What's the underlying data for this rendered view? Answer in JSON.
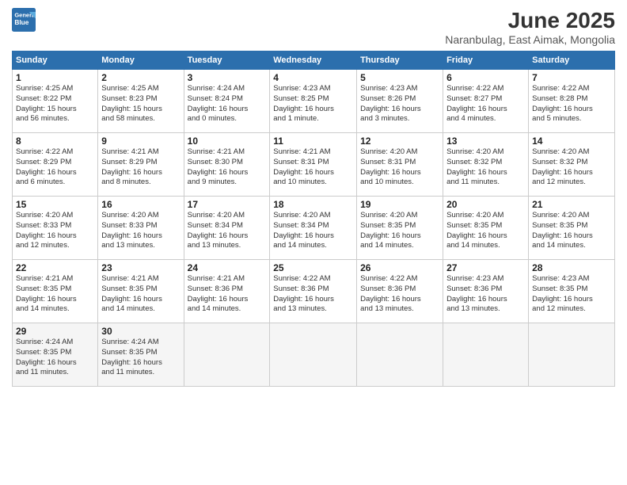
{
  "logo": {
    "line1": "General",
    "line2": "Blue"
  },
  "title": "June 2025",
  "subtitle": "Naranbulag, East Aimak, Mongolia",
  "days_of_week": [
    "Sunday",
    "Monday",
    "Tuesday",
    "Wednesday",
    "Thursday",
    "Friday",
    "Saturday"
  ],
  "weeks": [
    [
      {
        "day": "1",
        "info": "Sunrise: 4:25 AM\nSunset: 8:22 PM\nDaylight: 15 hours\nand 56 minutes."
      },
      {
        "day": "2",
        "info": "Sunrise: 4:25 AM\nSunset: 8:23 PM\nDaylight: 15 hours\nand 58 minutes."
      },
      {
        "day": "3",
        "info": "Sunrise: 4:24 AM\nSunset: 8:24 PM\nDaylight: 16 hours\nand 0 minutes."
      },
      {
        "day": "4",
        "info": "Sunrise: 4:23 AM\nSunset: 8:25 PM\nDaylight: 16 hours\nand 1 minute."
      },
      {
        "day": "5",
        "info": "Sunrise: 4:23 AM\nSunset: 8:26 PM\nDaylight: 16 hours\nand 3 minutes."
      },
      {
        "day": "6",
        "info": "Sunrise: 4:22 AM\nSunset: 8:27 PM\nDaylight: 16 hours\nand 4 minutes."
      },
      {
        "day": "7",
        "info": "Sunrise: 4:22 AM\nSunset: 8:28 PM\nDaylight: 16 hours\nand 5 minutes."
      }
    ],
    [
      {
        "day": "8",
        "info": "Sunrise: 4:22 AM\nSunset: 8:29 PM\nDaylight: 16 hours\nand 6 minutes."
      },
      {
        "day": "9",
        "info": "Sunrise: 4:21 AM\nSunset: 8:29 PM\nDaylight: 16 hours\nand 8 minutes."
      },
      {
        "day": "10",
        "info": "Sunrise: 4:21 AM\nSunset: 8:30 PM\nDaylight: 16 hours\nand 9 minutes."
      },
      {
        "day": "11",
        "info": "Sunrise: 4:21 AM\nSunset: 8:31 PM\nDaylight: 16 hours\nand 10 minutes."
      },
      {
        "day": "12",
        "info": "Sunrise: 4:20 AM\nSunset: 8:31 PM\nDaylight: 16 hours\nand 10 minutes."
      },
      {
        "day": "13",
        "info": "Sunrise: 4:20 AM\nSunset: 8:32 PM\nDaylight: 16 hours\nand 11 minutes."
      },
      {
        "day": "14",
        "info": "Sunrise: 4:20 AM\nSunset: 8:32 PM\nDaylight: 16 hours\nand 12 minutes."
      }
    ],
    [
      {
        "day": "15",
        "info": "Sunrise: 4:20 AM\nSunset: 8:33 PM\nDaylight: 16 hours\nand 12 minutes."
      },
      {
        "day": "16",
        "info": "Sunrise: 4:20 AM\nSunset: 8:33 PM\nDaylight: 16 hours\nand 13 minutes."
      },
      {
        "day": "17",
        "info": "Sunrise: 4:20 AM\nSunset: 8:34 PM\nDaylight: 16 hours\nand 13 minutes."
      },
      {
        "day": "18",
        "info": "Sunrise: 4:20 AM\nSunset: 8:34 PM\nDaylight: 16 hours\nand 14 minutes."
      },
      {
        "day": "19",
        "info": "Sunrise: 4:20 AM\nSunset: 8:35 PM\nDaylight: 16 hours\nand 14 minutes."
      },
      {
        "day": "20",
        "info": "Sunrise: 4:20 AM\nSunset: 8:35 PM\nDaylight: 16 hours\nand 14 minutes."
      },
      {
        "day": "21",
        "info": "Sunrise: 4:20 AM\nSunset: 8:35 PM\nDaylight: 16 hours\nand 14 minutes."
      }
    ],
    [
      {
        "day": "22",
        "info": "Sunrise: 4:21 AM\nSunset: 8:35 PM\nDaylight: 16 hours\nand 14 minutes."
      },
      {
        "day": "23",
        "info": "Sunrise: 4:21 AM\nSunset: 8:35 PM\nDaylight: 16 hours\nand 14 minutes."
      },
      {
        "day": "24",
        "info": "Sunrise: 4:21 AM\nSunset: 8:36 PM\nDaylight: 16 hours\nand 14 minutes."
      },
      {
        "day": "25",
        "info": "Sunrise: 4:22 AM\nSunset: 8:36 PM\nDaylight: 16 hours\nand 13 minutes."
      },
      {
        "day": "26",
        "info": "Sunrise: 4:22 AM\nSunset: 8:36 PM\nDaylight: 16 hours\nand 13 minutes."
      },
      {
        "day": "27",
        "info": "Sunrise: 4:23 AM\nSunset: 8:36 PM\nDaylight: 16 hours\nand 13 minutes."
      },
      {
        "day": "28",
        "info": "Sunrise: 4:23 AM\nSunset: 8:35 PM\nDaylight: 16 hours\nand 12 minutes."
      }
    ],
    [
      {
        "day": "29",
        "info": "Sunrise: 4:24 AM\nSunset: 8:35 PM\nDaylight: 16 hours\nand 11 minutes."
      },
      {
        "day": "30",
        "info": "Sunrise: 4:24 AM\nSunset: 8:35 PM\nDaylight: 16 hours\nand 11 minutes."
      },
      {
        "day": "",
        "info": ""
      },
      {
        "day": "",
        "info": ""
      },
      {
        "day": "",
        "info": ""
      },
      {
        "day": "",
        "info": ""
      },
      {
        "day": "",
        "info": ""
      }
    ]
  ]
}
